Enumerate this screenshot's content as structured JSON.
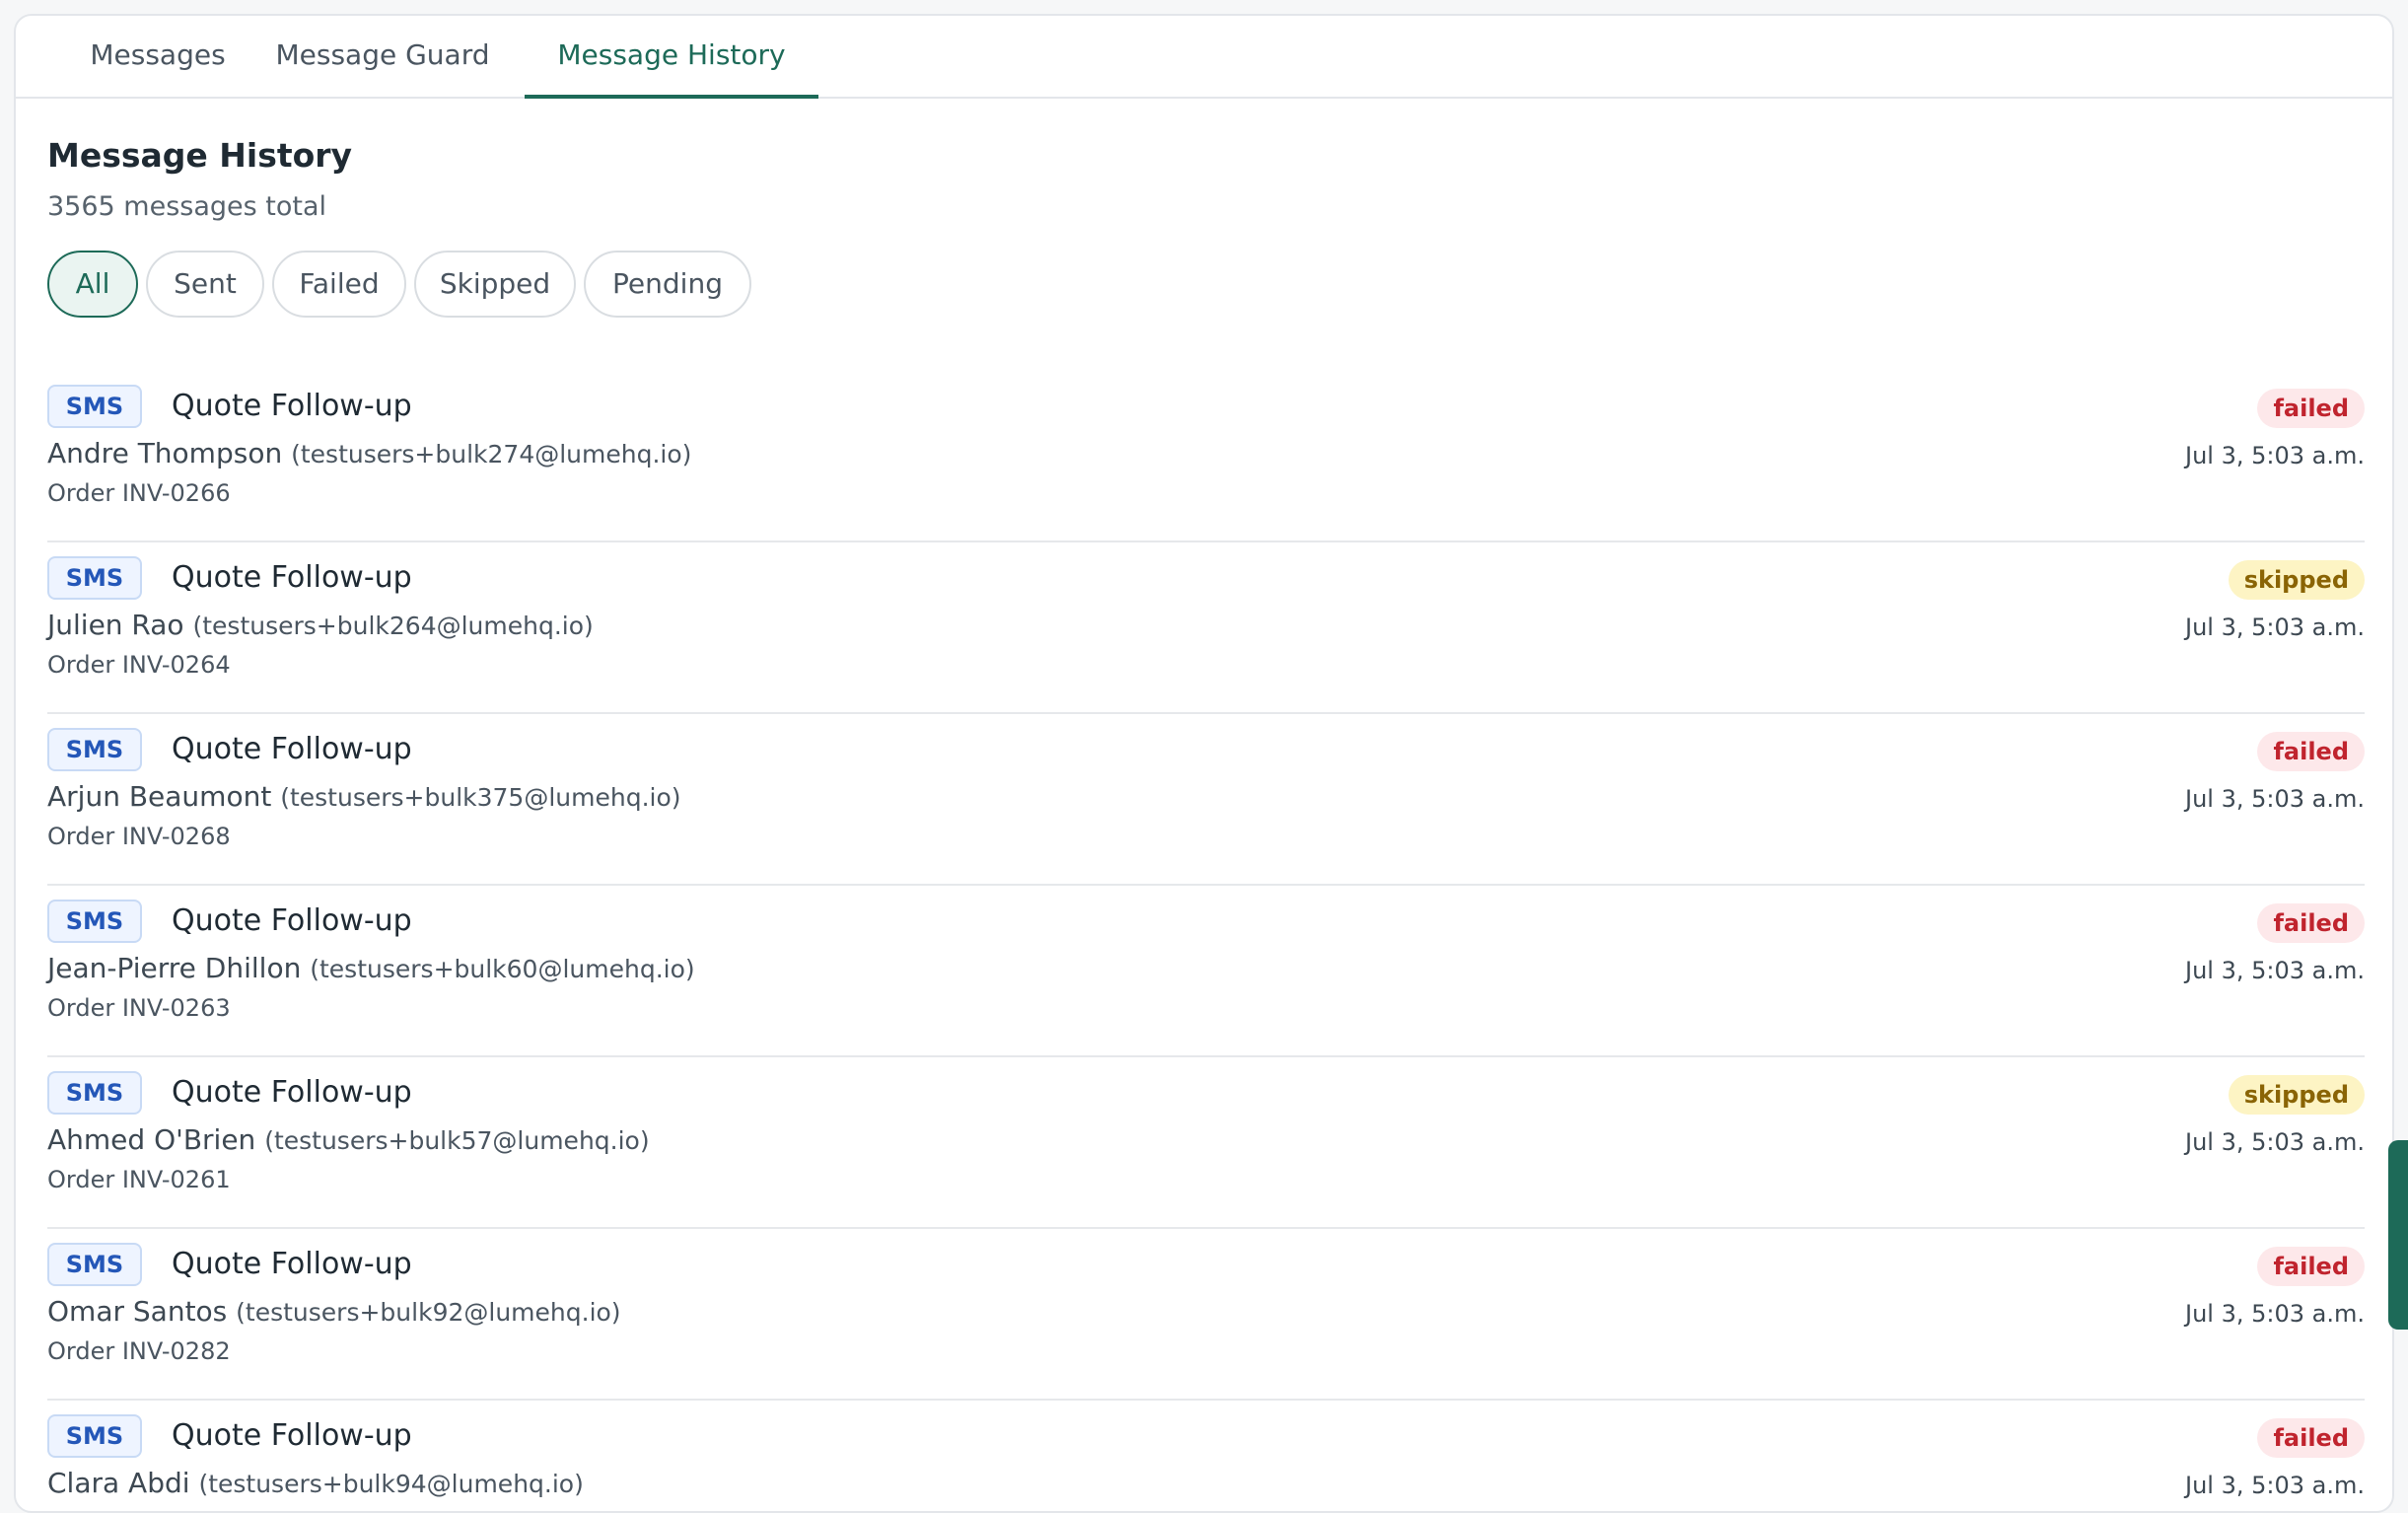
{
  "tabs": {
    "messages": "Messages",
    "guard": "Message Guard",
    "history": "Message History"
  },
  "page": {
    "title": "Message History",
    "total": "3565 messages total"
  },
  "filters": {
    "all": "All",
    "sent": "Sent",
    "failed": "Failed",
    "skipped": "Skipped",
    "pending": "Pending"
  },
  "colors": {
    "accent": "#1d6a58",
    "failed": "#c0242e",
    "skipped": "#8a6405",
    "channel": "#2457b8"
  },
  "messages": [
    {
      "channel": "SMS",
      "title": "Quote Follow-up",
      "name": "Andre Thompson",
      "email": "(testusers+bulk274@lumehq.io)",
      "order": "Order INV-0266",
      "status": "failed",
      "time": "Jul 3, 5:03 a.m."
    },
    {
      "channel": "SMS",
      "title": "Quote Follow-up",
      "name": "Julien Rao",
      "email": "(testusers+bulk264@lumehq.io)",
      "order": "Order INV-0264",
      "status": "skipped",
      "time": "Jul 3, 5:03 a.m."
    },
    {
      "channel": "SMS",
      "title": "Quote Follow-up",
      "name": "Arjun Beaumont",
      "email": "(testusers+bulk375@lumehq.io)",
      "order": "Order INV-0268",
      "status": "failed",
      "time": "Jul 3, 5:03 a.m."
    },
    {
      "channel": "SMS",
      "title": "Quote Follow-up",
      "name": "Jean-Pierre Dhillon",
      "email": "(testusers+bulk60@lumehq.io)",
      "order": "Order INV-0263",
      "status": "failed",
      "time": "Jul 3, 5:03 a.m."
    },
    {
      "channel": "SMS",
      "title": "Quote Follow-up",
      "name": "Ahmed O'Brien",
      "email": "(testusers+bulk57@lumehq.io)",
      "order": "Order INV-0261",
      "status": "skipped",
      "time": "Jul 3, 5:03 a.m."
    },
    {
      "channel": "SMS",
      "title": "Quote Follow-up",
      "name": "Omar Santos",
      "email": "(testusers+bulk92@lumehq.io)",
      "order": "Order INV-0282",
      "status": "failed",
      "time": "Jul 3, 5:03 a.m."
    },
    {
      "channel": "SMS",
      "title": "Quote Follow-up",
      "name": "Clara Abdi",
      "email": "(testusers+bulk94@lumehq.io)",
      "order": "",
      "status": "failed",
      "time": "Jul 3, 5:03 a.m."
    }
  ]
}
